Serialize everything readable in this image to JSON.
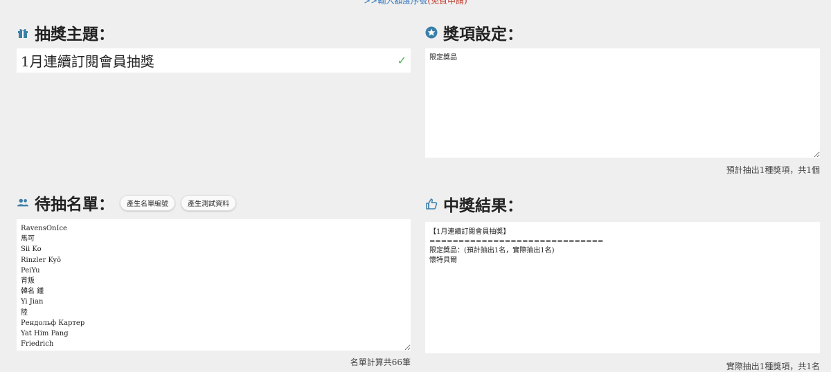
{
  "top_link": {
    "prefix": ">>輸入額度序號",
    "suffix": "(免費申請)"
  },
  "theme": {
    "heading": "抽獎主題：",
    "value": "1月連續訂閱會員抽獎"
  },
  "prizes": {
    "heading": "獎項設定：",
    "value": "限定獎品",
    "summary": "預計抽出1種獎項，共1個"
  },
  "candidates": {
    "heading": "待抽名單：",
    "btn_edit": "產生名單編號",
    "btn_test": "產生測試資料",
    "list": "RavensOnIce\n馬可\nSii Ko\nRinzler Kyō\nPeiYu\n背叛\n韓名 鍾\nYi Jian\n陸\nРендольф Картер\nYat Him Pang\nFriedrich",
    "summary": "名單計算共66筆"
  },
  "results": {
    "heading": "中獎結果：",
    "lines": "【1月連續訂閱會員抽獎】\n==============================\n限定獎品：(預計抽出1名，實際抽出1名)\n懷特貝爾",
    "summary": "實際抽出1種獎項，共1名"
  }
}
